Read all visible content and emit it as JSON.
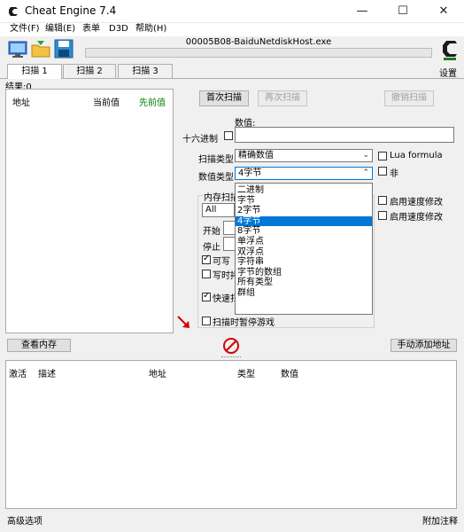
{
  "window": {
    "title": "Cheat Engine 7.4",
    "minimize": "—",
    "maximize": "☐",
    "close": "✕"
  },
  "menu": [
    "文件(F)",
    "编辑(E)",
    "表单",
    "D3D",
    "帮助(H)"
  ],
  "process_name": "00005B08-BaiduNetdiskHost.exe",
  "settings_label": "设置",
  "tabs": [
    "扫描 1",
    "扫描 2",
    "扫描 3"
  ],
  "results_label": "结果:0",
  "results_columns": [
    "地址",
    "当前值",
    "先前值"
  ],
  "buttons": {
    "first_scan": "首次扫描",
    "next_scan": "再次扫描",
    "undo_scan": "撤销扫描",
    "view_memory": "查看内存",
    "add_manual": "手动添加地址"
  },
  "value_label": "数值:",
  "hex_label": "十六进制",
  "scan_type_label": "扫描类型",
  "scan_type_value": "精确数值",
  "value_type_label": "数值类型",
  "value_type_value": "4字节",
  "lua_formula": "Lua formula",
  "not_label": "非",
  "memory_scan_label": "内存扫描",
  "memory_region_value": "All",
  "start_label": "开始",
  "stop_label": "停止",
  "writable_label": "可写",
  "copy_on_write_label": "写时拷",
  "fast_scan_label": "快速扫",
  "pause_game_label": "扫描时暂停游戏",
  "speedhack1": "启用速度修改",
  "speedhack2": "启用速度修改",
  "dropdown_options": [
    "二进制",
    "字节",
    "2字节",
    "4字节",
    "8字节",
    "单浮点",
    "双浮点",
    "字符串",
    "字节的数组",
    "所有类型",
    "群组"
  ],
  "dropdown_selected_index": 3,
  "table_columns": [
    "激活",
    "描述",
    "地址",
    "类型",
    "数值"
  ],
  "status": {
    "left": "高级选项",
    "right": "附加注释"
  },
  "colors": {
    "selected_bg": "#0078d7",
    "previous_value_header": "#008000",
    "no_icon": "#d40000"
  }
}
